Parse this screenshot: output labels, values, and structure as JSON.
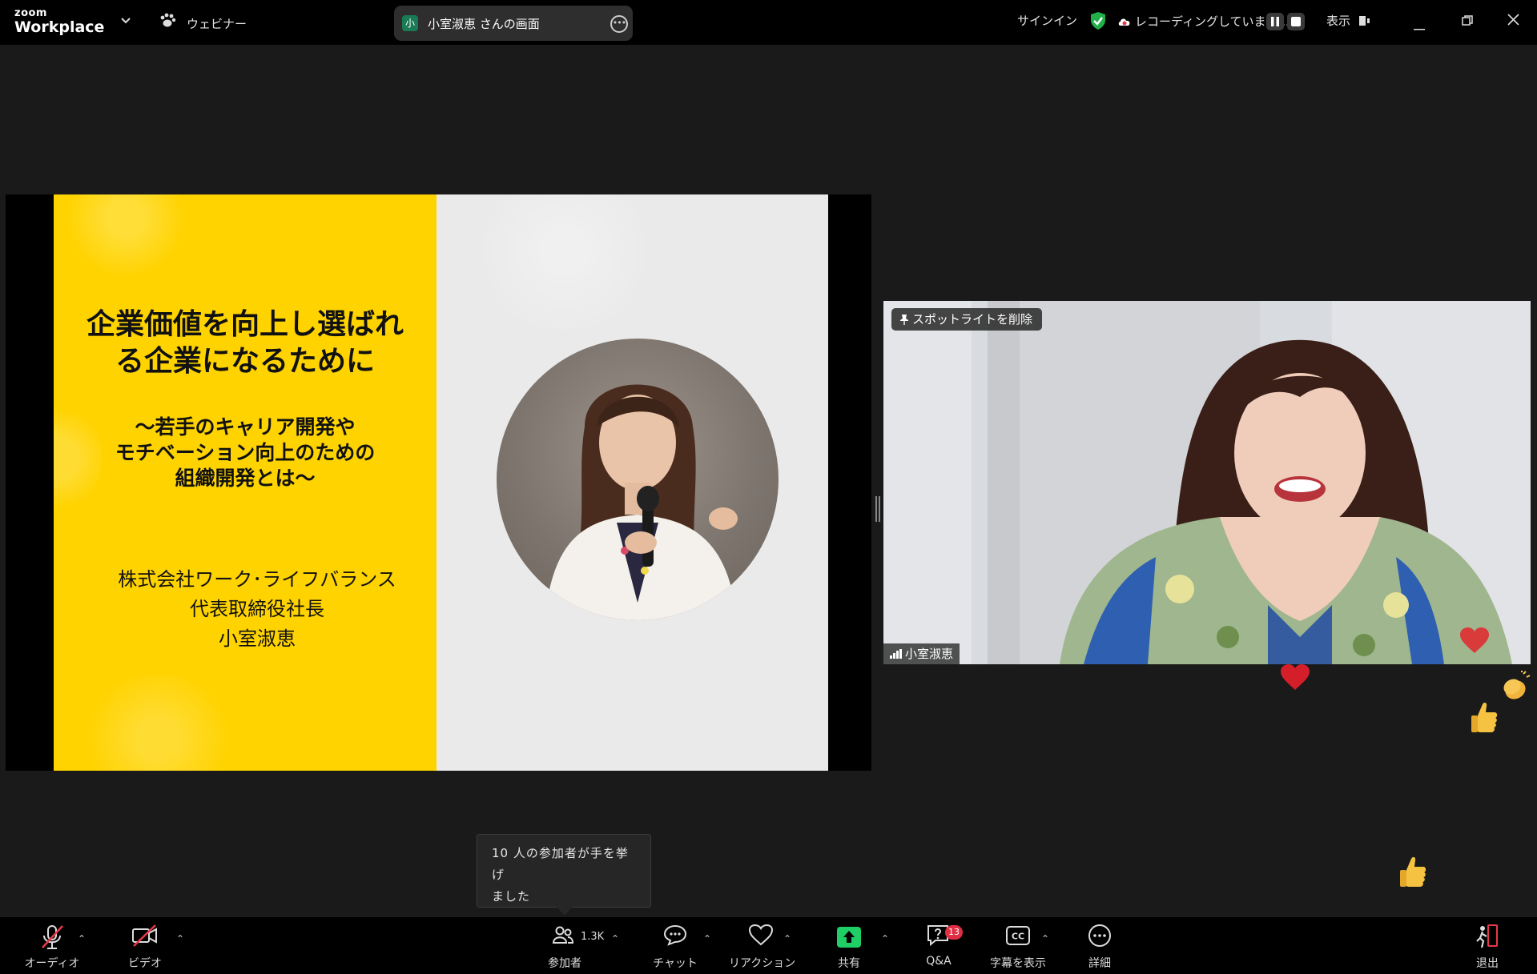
{
  "topbar": {
    "logo_small": "zoom",
    "logo_big": "Workplace",
    "webinar_label": "ウェビナー",
    "screen_share_avatar": "小",
    "screen_share_title": "小室淑恵 さんの画面",
    "signin": "サインイン",
    "recording_status": "レコーディングしています...",
    "view_label": "表示"
  },
  "slide": {
    "title_line1": "企業価値を向上し選ばれ",
    "title_line2": "る企業になるために",
    "sub_line1": "～若手のキャリア開発や",
    "sub_line2": "モチベーション向上のための",
    "sub_line3": "組織開発とは～",
    "company": "株式会社ワーク･ライフバランス",
    "role": "代表取締役社長",
    "name": "小室淑恵"
  },
  "video": {
    "spotlight_remove": "スポットライトを削除",
    "participant_name": "小室淑恵"
  },
  "notification": {
    "raised_hands_line1": "10 人の参加者が手を挙げ",
    "raised_hands_line2": "ました"
  },
  "toolbar": {
    "audio": "オーディオ",
    "video": "ビデオ",
    "participants": "参加者",
    "participants_count": "1.3K",
    "chat": "チャット",
    "reactions": "リアクション",
    "share": "共有",
    "qa": "Q&A",
    "qa_badge": "13",
    "captions": "字幕を表示",
    "more": "詳細",
    "leave": "退出"
  },
  "colors": {
    "slide_yellow": "#ffd300",
    "secure_green": "#22b04b",
    "share_green": "#1fcf65",
    "mute_red": "#e5394a",
    "badge_red": "#e02f44"
  },
  "icons": [
    "chevron-down-icon",
    "paw-icon",
    "more-icon",
    "shield-check-icon",
    "cloud-record-icon",
    "pause-icon",
    "stop-icon",
    "view-icon",
    "minimize-icon",
    "restore-icon",
    "close-icon",
    "pin-icon",
    "signal-icon",
    "mic-muted-icon",
    "camera-off-icon",
    "participants-icon",
    "chat-icon",
    "heart-icon",
    "share-up-icon",
    "qa-icon",
    "cc-icon",
    "ellipsis-icon",
    "exit-icon"
  ]
}
